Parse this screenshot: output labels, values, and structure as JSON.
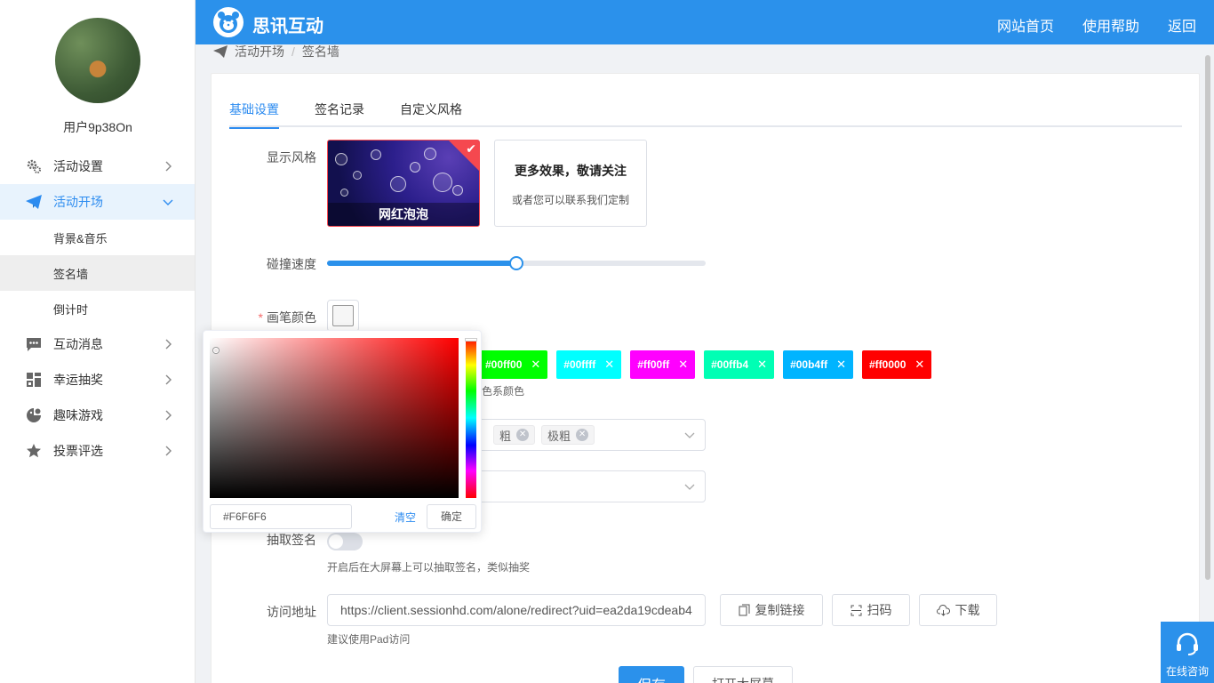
{
  "header": {
    "brand": "思讯互动",
    "nav": [
      "网站首页",
      "使用帮助",
      "返回"
    ]
  },
  "sidebar": {
    "username": "用户9p38On",
    "menu": [
      {
        "label": "活动设置",
        "icon": "gear-icon"
      },
      {
        "label": "活动开场",
        "icon": "paper-plane-icon",
        "expanded": true,
        "children": [
          "背景&音乐",
          "签名墙",
          "倒计时"
        ],
        "active_child": "签名墙"
      },
      {
        "label": "互动消息",
        "icon": "chat-icon"
      },
      {
        "label": "幸运抽奖",
        "icon": "lottery-icon"
      },
      {
        "label": "趣味游戏",
        "icon": "game-icon"
      },
      {
        "label": "投票评选",
        "icon": "star-icon"
      }
    ]
  },
  "breadcrumb": [
    "活动开场",
    "签名墙"
  ],
  "tabs": [
    "基础设置",
    "签名记录",
    "自定义风格"
  ],
  "active_tab": "基础设置",
  "form": {
    "display_style": {
      "label": "显示风格",
      "selected_name": "网红泡泡",
      "more_title": "更多效果，敬请关注",
      "more_sub": "或者您可以联系我们定制"
    },
    "speed": {
      "label": "碰撞速度",
      "value_fraction": 0.5
    },
    "pen_color": {
      "label": "画笔颜色",
      "required": true,
      "current": "#f6f6f6"
    },
    "color_tags": [
      {
        "label": "#00ff00",
        "color": "#00ff00"
      },
      {
        "label": "#00ffff",
        "color": "#00ffff"
      },
      {
        "label": "#ff00ff",
        "color": "#ff00ff"
      },
      {
        "label": "#00ffb4",
        "color": "#00ffb4"
      },
      {
        "label": "#00b4ff",
        "color": "#00b4ff"
      },
      {
        "label": "#ff0000",
        "color": "#ff0000"
      }
    ],
    "color_hint_tail": "色系颜色",
    "thickness_chips": [
      "粗",
      "极粗"
    ],
    "draw": {
      "label": "抽取签名",
      "enabled": false,
      "help": "开启后在大屏幕上可以抽取签名，类似抽奖"
    },
    "access": {
      "label": "访问地址",
      "url": "https://client.sessionhd.com/alone/redirect?uid=ea2da19cdeab4",
      "help": "建议使用Pad访问",
      "copy": "复制链接",
      "scan": "扫码",
      "download": "下载"
    },
    "save": "保存",
    "open_screen": "打开大屏幕"
  },
  "color_picker": {
    "hex": "#F6F6F6",
    "clear": "清空",
    "confirm": "确定"
  },
  "consult": "在线咨询"
}
